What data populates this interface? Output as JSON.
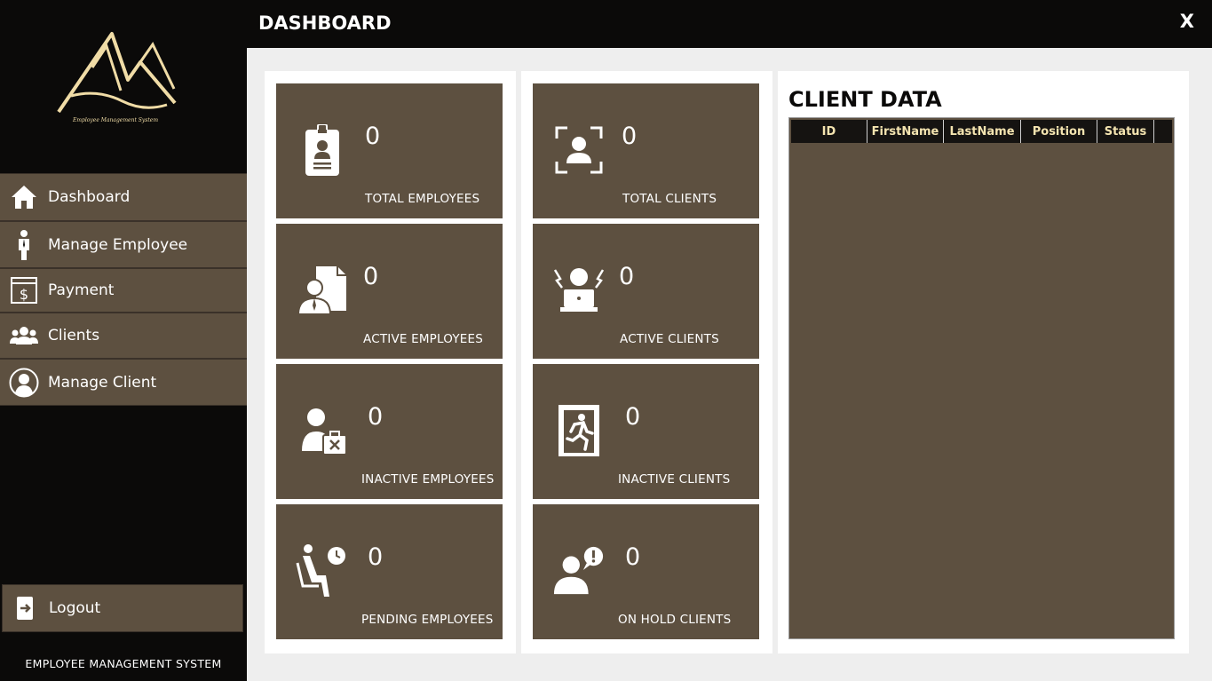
{
  "app": {
    "logo_caption": "Employee Management System",
    "footer_text": "EMPLOYEE MANAGEMENT SYSTEM"
  },
  "header": {
    "title": "DASHBOARD",
    "close_label": "X"
  },
  "sidebar": {
    "items": [
      {
        "label": "Dashboard",
        "icon": "home-icon"
      },
      {
        "label": "Manage Employee",
        "icon": "person-tie-icon"
      },
      {
        "label": "Payment",
        "icon": "dollar-bill-icon"
      },
      {
        "label": "Clients",
        "icon": "group-icon"
      },
      {
        "label": "Manage Client",
        "icon": "user-circle-icon"
      }
    ],
    "logout_label": "Logout"
  },
  "cards": {
    "employees": [
      {
        "value": "0",
        "label": "TOTAL EMPLOYEES",
        "icon": "id-badge-icon"
      },
      {
        "value": "0",
        "label": "ACTIVE EMPLOYEES",
        "icon": "employee-document-icon"
      },
      {
        "value": "0",
        "label": "INACTIVE EMPLOYEES",
        "icon": "employee-briefcase-x-icon"
      },
      {
        "value": "0",
        "label": "PENDING EMPLOYEES",
        "icon": "waiting-seat-clock-icon"
      }
    ],
    "clients": [
      {
        "value": "0",
        "label": "TOTAL CLIENTS",
        "icon": "user-focus-icon"
      },
      {
        "value": "0",
        "label": "ACTIVE CLIENTS",
        "icon": "user-laptop-icon"
      },
      {
        "value": "0",
        "label": "INACTIVE CLIENTS",
        "icon": "exit-door-icon"
      },
      {
        "value": "0",
        "label": "ON HOLD CLIENTS",
        "icon": "user-alert-icon"
      }
    ]
  },
  "client_data": {
    "title": "CLIENT DATA",
    "columns": [
      "ID",
      "FirstName",
      "LastName",
      "Position",
      "Status"
    ],
    "rows": []
  },
  "colors": {
    "sidebar_bg": "#0b0a09",
    "card_bg": "#5d5040",
    "accent_text": "#f4e4b0",
    "content_bg": "#eeeeee"
  }
}
